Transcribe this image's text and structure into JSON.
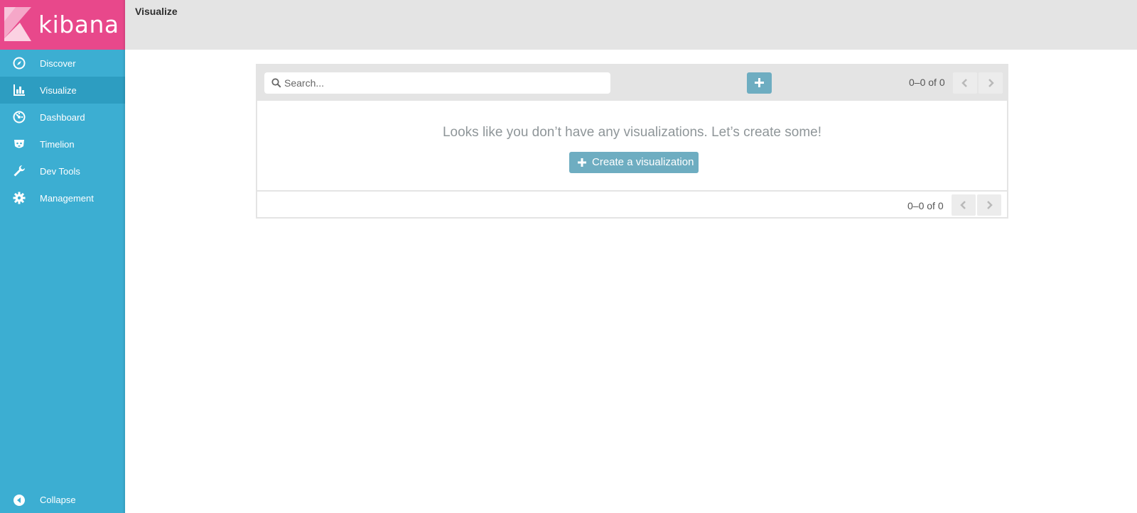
{
  "app": {
    "brand": "kibana",
    "accent": "#e8488b",
    "sidebar_color": "#3caed2"
  },
  "sidebar": {
    "items": [
      {
        "label": "Discover",
        "icon": "compass-icon",
        "active": false
      },
      {
        "label": "Visualize",
        "icon": "bar-chart-icon",
        "active": true
      },
      {
        "label": "Dashboard",
        "icon": "dashboard-gauge-icon",
        "active": false
      },
      {
        "label": "Timelion",
        "icon": "timelion-icon",
        "active": false
      },
      {
        "label": "Dev Tools",
        "icon": "wrench-icon",
        "active": false
      },
      {
        "label": "Management",
        "icon": "gear-icon",
        "active": false
      }
    ],
    "collapse_label": "Collapse"
  },
  "header": {
    "title": "Visualize"
  },
  "toolbar": {
    "search_placeholder": "Search...",
    "pager_text": "0–0 of 0"
  },
  "main": {
    "empty_message": "Looks like you don’t have any visualizations. Let’s create some!",
    "create_label": "Create a visualization"
  },
  "footer": {
    "pager_text": "0–0 of 0"
  }
}
